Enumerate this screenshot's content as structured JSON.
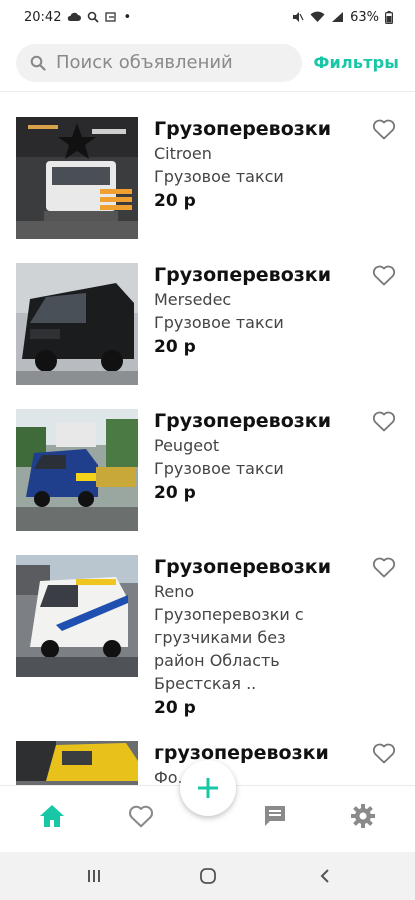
{
  "status_bar": {
    "time": "20:42",
    "battery": "63%",
    "dot": "•"
  },
  "header": {
    "search_placeholder": "Поиск объявлений",
    "filters_label": "Фильтры"
  },
  "listings": [
    {
      "title": "Грузоперевозки",
      "brand": "Citroen",
      "description": "Грузовое такси",
      "price": "20 р"
    },
    {
      "title": "Грузоперевозки",
      "brand": "Mersedec",
      "description": "Грузовое такси",
      "price": "20 р"
    },
    {
      "title": "Грузоперевозки",
      "brand": "Peugeot",
      "description": "Грузовое такси",
      "price": "20 р"
    },
    {
      "title": "Грузоперевозки",
      "brand": "Reno",
      "description_lines": [
        "Грузоперевозки с",
        "грузчиками без",
        "район Область",
        "Брестская .."
      ],
      "price": "20 р"
    },
    {
      "title": "грузоперевозки",
      "brand": "Фо..."
    }
  ],
  "bottom_nav": {
    "items": [
      "home-icon",
      "heart-icon",
      "add-icon",
      "chat-icon",
      "settings-icon"
    ],
    "active": "home-icon"
  },
  "colors": {
    "accent": "#17c7a6",
    "icon_inactive": "#8a8a8a",
    "text_primary": "#111111",
    "text_secondary": "#444444"
  }
}
